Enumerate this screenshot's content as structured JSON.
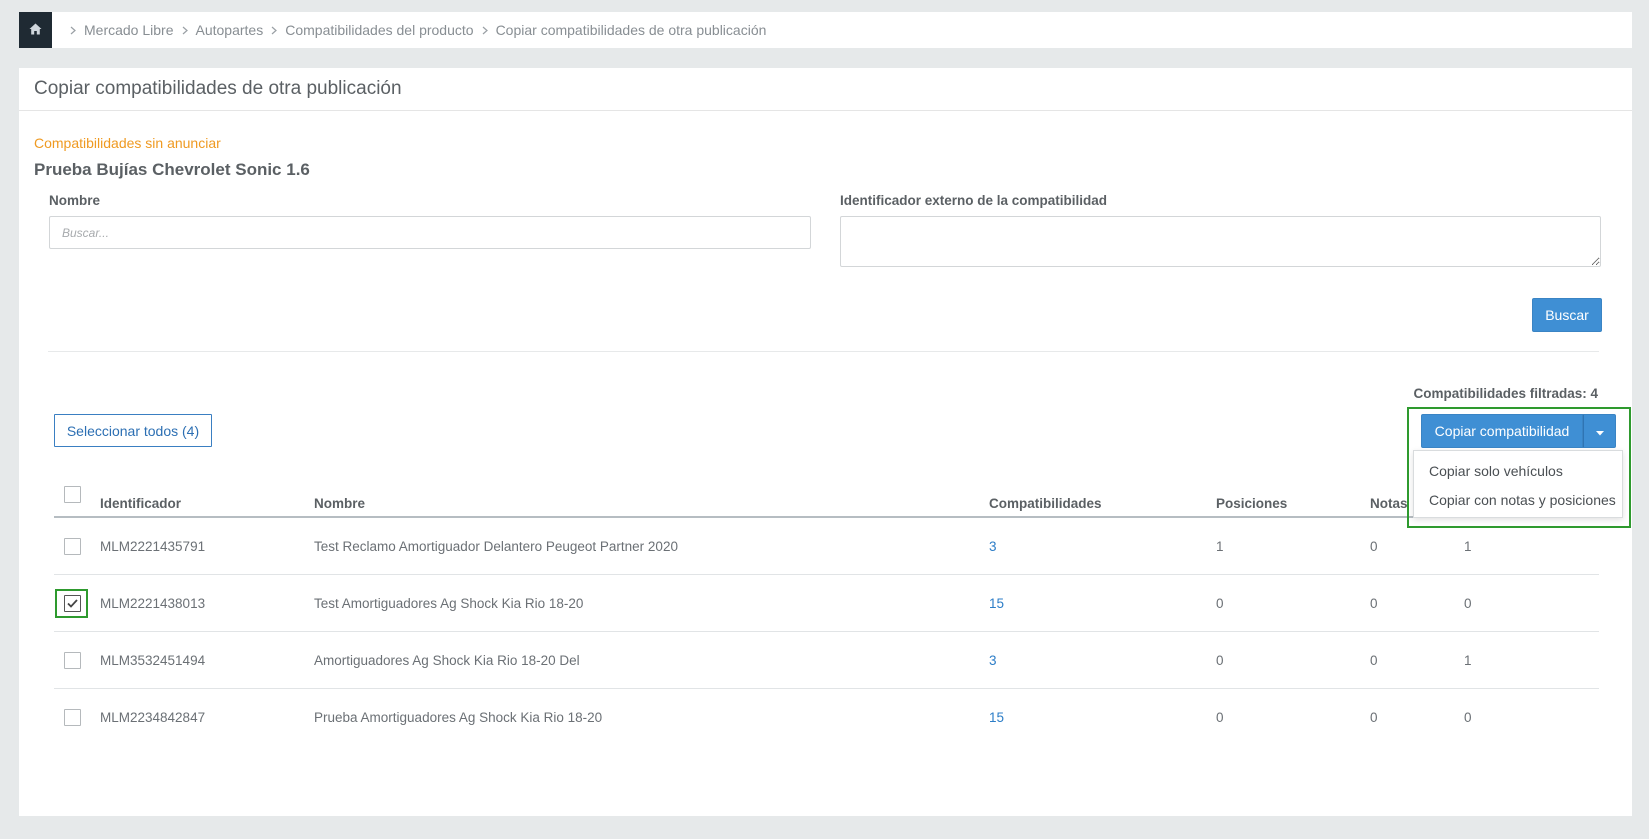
{
  "breadcrumb": {
    "items": [
      "Mercado Libre",
      "Autopartes",
      "Compatibilidades del producto",
      "Copiar compatibilidades de otra publicación"
    ]
  },
  "panel": {
    "title": "Copiar compatibilidades de otra publicación",
    "subtitle": "Compatibilidades sin anunciar",
    "product_name": "Prueba Bujías Chevrolet Sonic 1.6"
  },
  "filters": {
    "name_label": "Nombre",
    "name_placeholder": "Buscar...",
    "name_value": "",
    "external_id_label": "Identificador externo de la compatibilidad",
    "external_id_value": "",
    "search_button": "Buscar"
  },
  "results": {
    "count_label": "Compatibilidades filtradas: 4",
    "select_all_button": "Seleccionar todos (4)",
    "copy_button": "Copiar compatibilidad",
    "copy_menu": [
      "Copiar solo vehículos",
      "Copiar con notas y posiciones"
    ]
  },
  "table": {
    "columns": [
      "Identificador",
      "Nombre",
      "Compatibilidades",
      "Posiciones",
      "Notas"
    ],
    "rows": [
      {
        "id": "MLM2221435791",
        "name": "Test Reclamo Amortiguador Delantero Peugeot Partner 2020",
        "compat": "3",
        "positions": "1",
        "notes": "0",
        "extra": "1",
        "checked": false
      },
      {
        "id": "MLM2221438013",
        "name": "Test Amortiguadores Ag Shock Kia Rio 18-20",
        "compat": "15",
        "positions": "0",
        "notes": "0",
        "extra": "0",
        "checked": true
      },
      {
        "id": "MLM3532451494",
        "name": "Amortiguadores Ag Shock Kia Rio 18-20 Del",
        "compat": "3",
        "positions": "0",
        "notes": "0",
        "extra": "1",
        "checked": false
      },
      {
        "id": "MLM2234842847",
        "name": "Prueba Amortiguadores Ag Shock Kia Rio 18-20",
        "compat": "15",
        "positions": "0",
        "notes": "0",
        "extra": "0",
        "checked": false
      }
    ]
  },
  "colors": {
    "primary": "#3f8fd4",
    "subtitle": "#ef9a22",
    "highlight": "#2e9a2e",
    "link": "#2c7dc7"
  },
  "icons": {
    "home": "home-icon",
    "separator": "chevron-right-icon",
    "caret": "caret-down-icon",
    "check": "check-icon"
  }
}
